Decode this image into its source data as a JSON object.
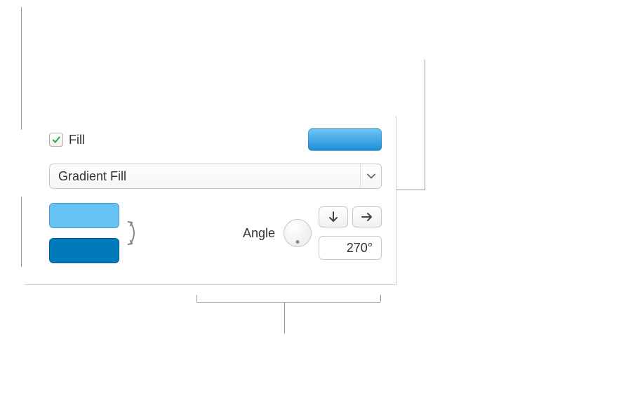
{
  "fill": {
    "label": "Fill",
    "checked": true,
    "type_label": "Gradient Fill",
    "preview_gradient": [
      "#6DC5F5",
      "#1D8FD6"
    ],
    "colors": [
      "#65C2F3",
      "#007AB8"
    ],
    "angle_label": "Angle",
    "angle_value": "270°"
  }
}
